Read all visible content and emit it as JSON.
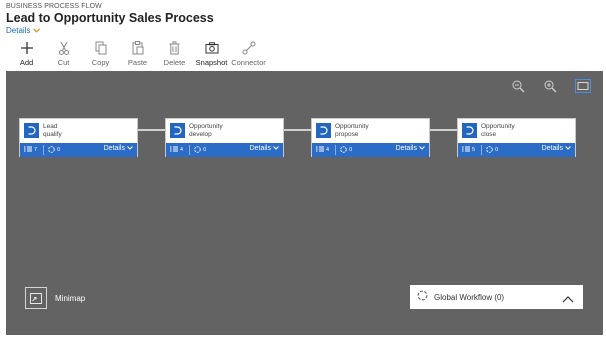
{
  "header": {
    "kicker": "BUSINESS PROCESS FLOW",
    "title": "Lead to Opportunity Sales Process",
    "details_label": "Details"
  },
  "toolbar": {
    "add": "Add",
    "cut": "Cut",
    "copy": "Copy",
    "paste": "Paste",
    "delete": "Delete",
    "snapshot": "Snapshot",
    "connector": "Connector"
  },
  "stages": [
    {
      "entity": "Lead",
      "name": "qualify",
      "steps": "7",
      "workflows": "0",
      "details": "Details"
    },
    {
      "entity": "Opportunity",
      "name": "develop",
      "steps": "4",
      "workflows": "0",
      "details": "Details"
    },
    {
      "entity": "Opportunity",
      "name": "propose",
      "steps": "4",
      "workflows": "0",
      "details": "Details"
    },
    {
      "entity": "Opportunity",
      "name": "close",
      "steps": "5",
      "workflows": "0",
      "details": "Details"
    }
  ],
  "minimap_label": "Minimap",
  "global_workflow_label": "Global Workflow (0)",
  "icons": {
    "add": "plus-icon",
    "cut": "scissors-icon",
    "copy": "copy-icon",
    "paste": "paste-icon",
    "delete": "trash-icon",
    "snapshot": "camera-icon",
    "connector": "connector-icon",
    "zoom_out": "zoom-out-icon",
    "zoom_in": "zoom-in-icon",
    "fit": "fit-to-screen-icon",
    "stage": "stage-icon",
    "steps": "steps-icon",
    "workflow": "workflow-icon",
    "minimap": "minimap-icon",
    "global_workflow": "workflow-icon",
    "collapse": "chevron-up-icon"
  },
  "colors": {
    "canvas": "#636363",
    "stage_bar": "#2b6dc6",
    "stage_icon": "#2266c0",
    "link": "#1a6ec0",
    "details_chevron": "#e08a1e"
  }
}
